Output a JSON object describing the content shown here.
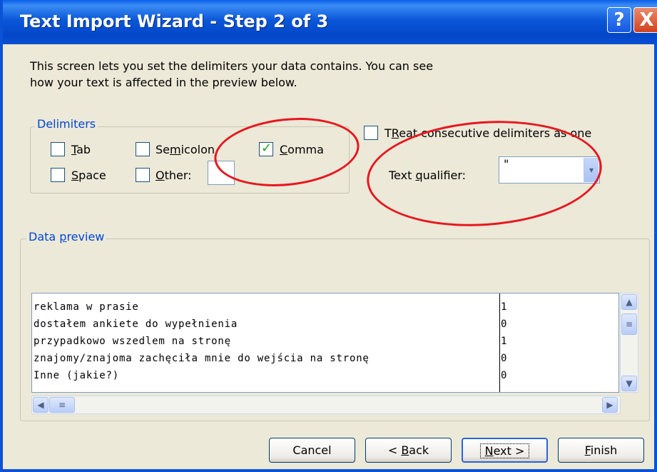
{
  "window": {
    "title": "Text Import Wizard - Step 2 of 3",
    "help_label": "?",
    "close_label": "X"
  },
  "intro": {
    "line1": "This screen lets you set the delimiters your data contains.  You can see",
    "line2": "how your text is affected in the preview below."
  },
  "delimiters": {
    "group_label": "Delimiters",
    "tab": {
      "label_ul": "T",
      "label_rest": "ab",
      "checked": false
    },
    "semicolon": {
      "label_pre": "Se",
      "label_ul": "m",
      "label_rest": "icolon",
      "checked": false
    },
    "comma": {
      "label_ul": "C",
      "label_rest": "omma",
      "checked": true
    },
    "space": {
      "label_ul": "S",
      "label_rest": "pace",
      "checked": false
    },
    "other": {
      "label_ul": "O",
      "label_rest": "ther:",
      "checked": false,
      "value": ""
    }
  },
  "options": {
    "consecutive": {
      "label_ul": "R",
      "label_pre": "T",
      "label_rest": "eat consecutive delimiters as one",
      "checked": false
    },
    "qualifier_label_pre": "Text ",
    "qualifier_label_ul": "q",
    "qualifier_label_rest": "ualifier:",
    "qualifier_value": "\"",
    "qualifier_arrow": "▾"
  },
  "preview": {
    "group_label_ul": "p",
    "group_label_pre": "Data ",
    "group_label_rest": "review",
    "rows": [
      {
        "col1": "reklama w prasie",
        "col2": "1"
      },
      {
        "col1": "dostałem ankiete do wypełnienia",
        "col2": "0"
      },
      {
        "col1": "przypadkowo wszedlem na stronę",
        "col2": "1"
      },
      {
        "col1": "znajomy/znajoma zachęciła mnie do wejścia na stronę",
        "col2": "0"
      },
      {
        "col1": "Inne (jakie?)",
        "col2": "0"
      }
    ]
  },
  "scroll": {
    "up": "▲",
    "down": "▼",
    "left": "◀",
    "right": "▶",
    "grip": "≡"
  },
  "buttons": {
    "cancel": "Cancel",
    "back_pre": "< ",
    "back_ul": "B",
    "back_rest": "ack",
    "next_ul": "N",
    "next_rest": "ext >",
    "finish_ul": "F",
    "finish_rest": "inish"
  },
  "colors": {
    "annotation": "#e8161e",
    "title_bar": "#0a53d6",
    "dialog_bg": "#ece9d8"
  }
}
